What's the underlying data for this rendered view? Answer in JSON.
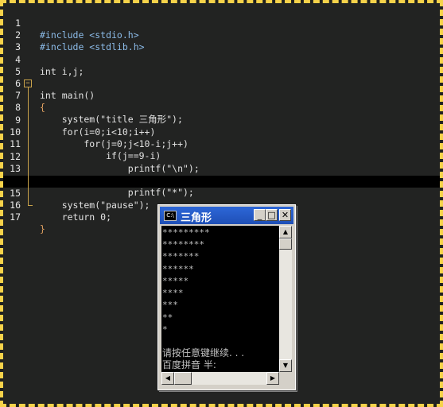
{
  "editor": {
    "lines": [
      {
        "n": "1",
        "code": "#include <stdio.h>"
      },
      {
        "n": "2",
        "code": "#include <stdlib.h>"
      },
      {
        "n": "3",
        "code": ""
      },
      {
        "n": "4",
        "code": "int i,j;"
      },
      {
        "n": "5",
        "code": ""
      },
      {
        "n": "6",
        "code": "int main()"
      },
      {
        "n": "7",
        "code": "{"
      },
      {
        "n": "8",
        "code": "    system(\"title 三角形\");"
      },
      {
        "n": "9",
        "code": "    for(i=0;i<10;i++)"
      },
      {
        "n": "10",
        "code": "        for(j=0;j<10-i;j++)"
      },
      {
        "n": "11",
        "code": "            if(j==9-i)"
      },
      {
        "n": "12",
        "code": "                printf(\"\\n\");"
      },
      {
        "n": "13",
        "code": "            else"
      },
      {
        "n": "14",
        "code": "                printf(\"*\");"
      },
      {
        "n": "15",
        "code": "    system(\"pause\");"
      },
      {
        "n": "16",
        "code": "    return 0;"
      },
      {
        "n": "17",
        "code": "}"
      }
    ],
    "fold_symbol": "−",
    "current_line": "15"
  },
  "console": {
    "title": "三角形",
    "icon_label": "C:\\",
    "buttons": {
      "minimize": "_",
      "maximize": "□",
      "close": "✕"
    },
    "output": [
      "*********",
      "********",
      "*******",
      "******",
      "*****",
      "****",
      "***",
      "**",
      "*",
      "",
      "请按任意键继续. . .",
      "百度拼音 半:"
    ],
    "scroll": {
      "up": "▲",
      "down": "▼",
      "left": "◀",
      "right": "▶"
    }
  },
  "colors": {
    "accent": "#f6d24a",
    "titlebar": "#2d67d8",
    "editor_bg": "#222322"
  }
}
